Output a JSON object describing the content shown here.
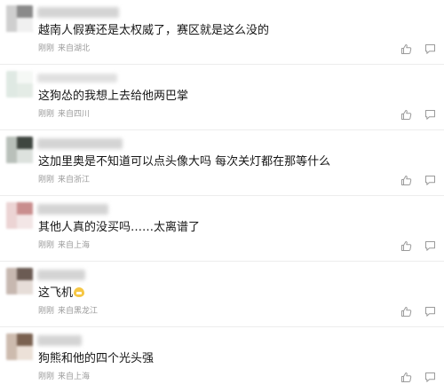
{
  "comments": [
    {
      "text": "越南人假赛还是太权威了，赛区就是这么没的",
      "time": "刚刚",
      "location": "来自湖北",
      "avatar_colors": [
        "#5c5c5c",
        "#cfcfcf",
        "#8a8a8a",
        "#f0f0f0"
      ]
    },
    {
      "text": "这狗怂的我想上去给他两巴掌",
      "time": "刚刚",
      "location": "来自四川",
      "avatar_colors": [
        "#e9efe9",
        "#dfe9e3",
        "#f5f8f5",
        "#e4ece6"
      ]
    },
    {
      "text": "这加里奥是不知道可以点头像大吗 每次关灯都在那等什么",
      "time": "刚刚",
      "location": "来自浙江",
      "avatar_colors": [
        "#6f7670",
        "#b9c0ba",
        "#3f4640",
        "#dde2de"
      ]
    },
    {
      "text": "其他人真的没买吗……太离谱了",
      "time": "刚刚",
      "location": "来自上海",
      "avatar_colors": [
        "#d8a6a6",
        "#ecd4d4",
        "#c98e8e",
        "#f3e6e6"
      ]
    },
    {
      "text": "这飞机",
      "time": "刚刚",
      "location": "来自黑龙江",
      "avatar_colors": [
        "#8b7b73",
        "#c7b8b0",
        "#6b5b53",
        "#e6ddd8"
      ]
    },
    {
      "text": "狗熊和他的四个光头强",
      "time": "刚刚",
      "location": "来自上海",
      "avatar_colors": [
        "#9a8170",
        "#cdbbae",
        "#7a6150",
        "#ece1d8"
      ]
    }
  ],
  "icons": {
    "like": "thumbs-up-icon",
    "reply": "comment-icon"
  },
  "colors": {
    "meta_text": "#9a9a9a",
    "icon_stroke": "#9a9a9a",
    "divider": "#ededed"
  }
}
